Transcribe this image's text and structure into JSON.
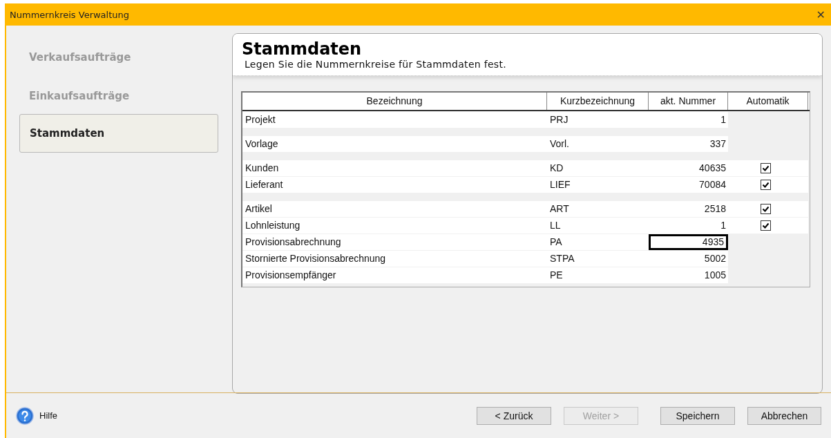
{
  "window": {
    "title": "Nummernkreis Verwaltung",
    "close": "✕"
  },
  "sidebar": {
    "items": [
      {
        "label": "Verkaufsaufträge",
        "selected": false
      },
      {
        "label": "Einkaufsaufträge",
        "selected": false
      },
      {
        "label": "Stammdaten",
        "selected": true
      }
    ]
  },
  "header": {
    "title": "Stammdaten",
    "subtitle": "Legen Sie die Nummernkreise für Stammdaten fest."
  },
  "table": {
    "columns": [
      "Bezeichnung",
      "Kurzbezeichnung",
      "akt. Nummer",
      "Automatik"
    ],
    "rows": [
      {
        "name": "Projekt",
        "short": "PRJ",
        "number": "1",
        "group_start": false,
        "focused": false
      },
      {
        "name": "Vorlage",
        "short": "Vorl.",
        "number": "337",
        "group_start": true,
        "focused": false
      },
      {
        "name": "Kunden",
        "short": "KD",
        "number": "40635",
        "group_start": true,
        "focused": false,
        "checked": true
      },
      {
        "name": "Lieferant",
        "short": "LIEF",
        "number": "70084",
        "group_start": false,
        "focused": false,
        "checked": true
      },
      {
        "name": "Artikel",
        "short": "ART",
        "number": "2518",
        "group_start": true,
        "focused": false,
        "checked": true
      },
      {
        "name": "Lohnleistung",
        "short": "LL",
        "number": "1",
        "group_start": false,
        "focused": false,
        "checked": true
      },
      {
        "name": "Provisionsabrechnung",
        "short": "PA",
        "number": "4935",
        "group_start": false,
        "focused": true
      },
      {
        "name": "Stornierte Provisionsabrechnung",
        "short": "STPA",
        "number": "5002",
        "group_start": false,
        "focused": false
      },
      {
        "name": "Provisionsempfänger",
        "short": "PE",
        "number": "1005",
        "group_start": false,
        "focused": false
      }
    ]
  },
  "footer": {
    "help": "Hilfe",
    "buttons": [
      {
        "label": "< Zurück",
        "disabled": false
      },
      {
        "label": "Weiter >",
        "disabled": true
      },
      {
        "label": "Speichern",
        "disabled": false
      },
      {
        "label": "Abbrechen",
        "disabled": false
      }
    ]
  }
}
